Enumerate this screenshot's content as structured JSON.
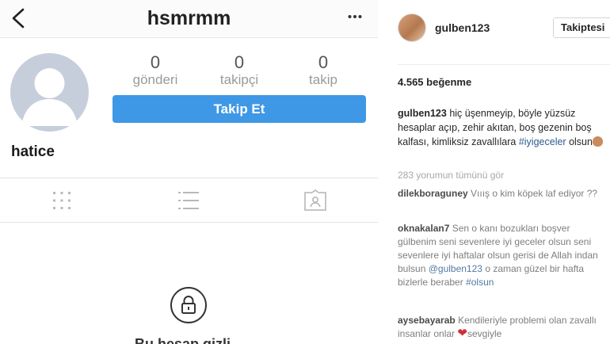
{
  "left_profile": {
    "username": "hsmrmm",
    "stats": [
      {
        "number": "0",
        "label": "gönderi"
      },
      {
        "number": "0",
        "label": "takipçi"
      },
      {
        "number": "0",
        "label": "takip"
      }
    ],
    "follow_button": "Takip Et",
    "display_name": "hatice",
    "icons": {
      "back": "chevron-left-icon",
      "more": "more-horizontal-icon",
      "grid": "grid-icon",
      "list": "list-icon",
      "tagged": "tagged-icon",
      "lock": "lock-icon"
    },
    "private_text_partial": "Bu hesap gizli"
  },
  "right_post": {
    "username": "gulben123",
    "follow_button": "Takiptesi",
    "likes": "4.565 beğenme",
    "caption": {
      "user": "gulben123",
      "text": "hiç üşenmeyip, böyle yüzsüz hesaplar açıp, zehir akıtan, boş gezenin boş kalfası, kimliksiz zavallılara",
      "hashtag": "#iyigeceler",
      "suffix": "olsun"
    },
    "view_all_comments": "283 yorumun tümünü gör",
    "comments": [
      {
        "user": "dilekboraguney",
        "text": "Vııış o kim köpek laf ediyor ??"
      },
      {
        "user": "oknakalan7",
        "text": "Sen o kanı bozukları boşver gülbenim seni sevenlere iyi geceler olsun seni sevenlere iyi haftalar olsun gerisi de Allah indan bulsun",
        "mention": "@gulben123",
        "text_after": "o zaman güzel bir hafta bizlerle beraber",
        "hashtag": "#olsun"
      },
      {
        "user": "aysebayarab",
        "text": "Kendileriyle problemi olan zavallı insanlar onlar",
        "suffix": "sevgiyle"
      }
    ],
    "colors": {
      "link": "#2c5b8e",
      "heart": "#d0303b",
      "follow_blue": "#3f98e6"
    }
  }
}
